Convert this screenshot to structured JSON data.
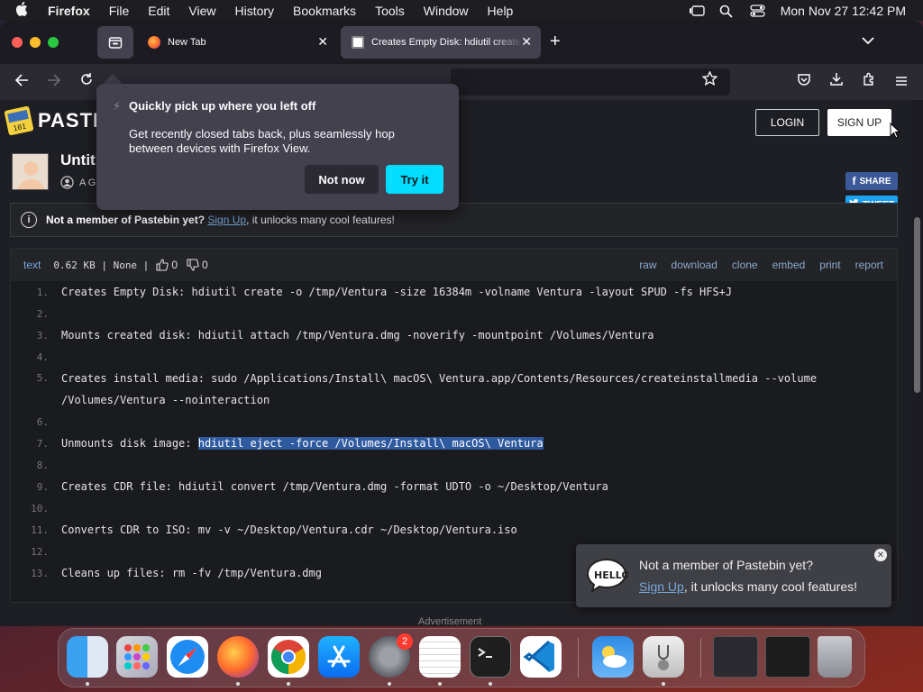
{
  "menubar": {
    "app": "Firefox",
    "items": [
      "File",
      "Edit",
      "View",
      "History",
      "Bookmarks",
      "Tools",
      "Window",
      "Help"
    ],
    "datetime": "Mon Nov 27  12:42 PM"
  },
  "tabs": [
    {
      "title": "New Tab",
      "active": false
    },
    {
      "title": "Creates Empty Disk: hdiutil create",
      "active": true
    }
  ],
  "popup": {
    "title": "Quickly pick up where you left off",
    "body": "Get recently closed tabs back, plus seamlessly hop between devices with Firefox View.",
    "not_now": "Not now",
    "try_it": "Try it"
  },
  "site": {
    "logo_text": "PASTE",
    "login": "LOGIN",
    "signup": "SIGN UP",
    "paste_title": "Untitl",
    "user": "A GU",
    "share": "SHARE",
    "tweet": "TWEET"
  },
  "notice": {
    "bold": "Not a member of Pastebin yet?",
    "link": "Sign Up",
    "rest": ", it unlocks many cool features!"
  },
  "code_header": {
    "type": "text",
    "meta": "0.62 KB | None |",
    "likes": "0",
    "dislikes": "0",
    "actions": [
      "raw",
      "download",
      "clone",
      "embed",
      "print",
      "report"
    ]
  },
  "code_lines": [
    {
      "n": "1.",
      "text": "Creates Empty Disk: hdiutil create -o /tmp/Ventura -size 16384m -volname Ventura -layout SPUD -fs HFS+J"
    },
    {
      "n": "2.",
      "text": ""
    },
    {
      "n": "3.",
      "text": "Mounts created disk: hdiutil attach /tmp/Ventura.dmg -noverify -mountpoint /Volumes/Ventura"
    },
    {
      "n": "4.",
      "text": ""
    },
    {
      "n": "5.",
      "text": "Creates install media: sudo /Applications/Install\\ macOS\\ Ventura.app/Contents/Resources/createinstallmedia --volume /Volumes/Ventura --nointeraction"
    },
    {
      "n": "6.",
      "text": ""
    },
    {
      "n": "7.",
      "text_before": "Unmounts disk image: ",
      "highlight": "hdiutil eject -force /Volumes/Install\\ macOS\\ Ventura"
    },
    {
      "n": "8.",
      "text": ""
    },
    {
      "n": "9.",
      "text": "Creates CDR file: hdiutil convert /tmp/Ventura.dmg -format UDTO -o ~/Desktop/Ventura"
    },
    {
      "n": "10.",
      "text": ""
    },
    {
      "n": "11.",
      "text": "Converts CDR to ISO: mv -v ~/Desktop/Ventura.cdr ~/Desktop/Ventura.iso"
    },
    {
      "n": "12.",
      "text": ""
    },
    {
      "n": "13.",
      "text": "Cleans up files: rm -fv /tmp/Ventura.dmg"
    }
  ],
  "toast": {
    "line1": "Not a member of Pastebin yet?",
    "link": "Sign Up",
    "rest": ", it unlocks many cool features!"
  },
  "advertisement": "Advertisement",
  "dock": {
    "apps": [
      "finder-icon",
      "launchpad-icon",
      "safari-icon",
      "firefox-icon",
      "chrome-icon",
      "app-store-icon",
      "system-settings-icon",
      "textedit-icon",
      "terminal-icon",
      "vscode-icon",
      "weather-icon",
      "disk-utility-icon",
      "firefox-window-thumbnail",
      "terminal-window-thumbnail",
      "trash-icon"
    ],
    "settings_badge": "2"
  },
  "colors": {
    "accent_try": "#00ddff",
    "highlight": "#2f5aa0",
    "link": "#7aa7d9"
  }
}
